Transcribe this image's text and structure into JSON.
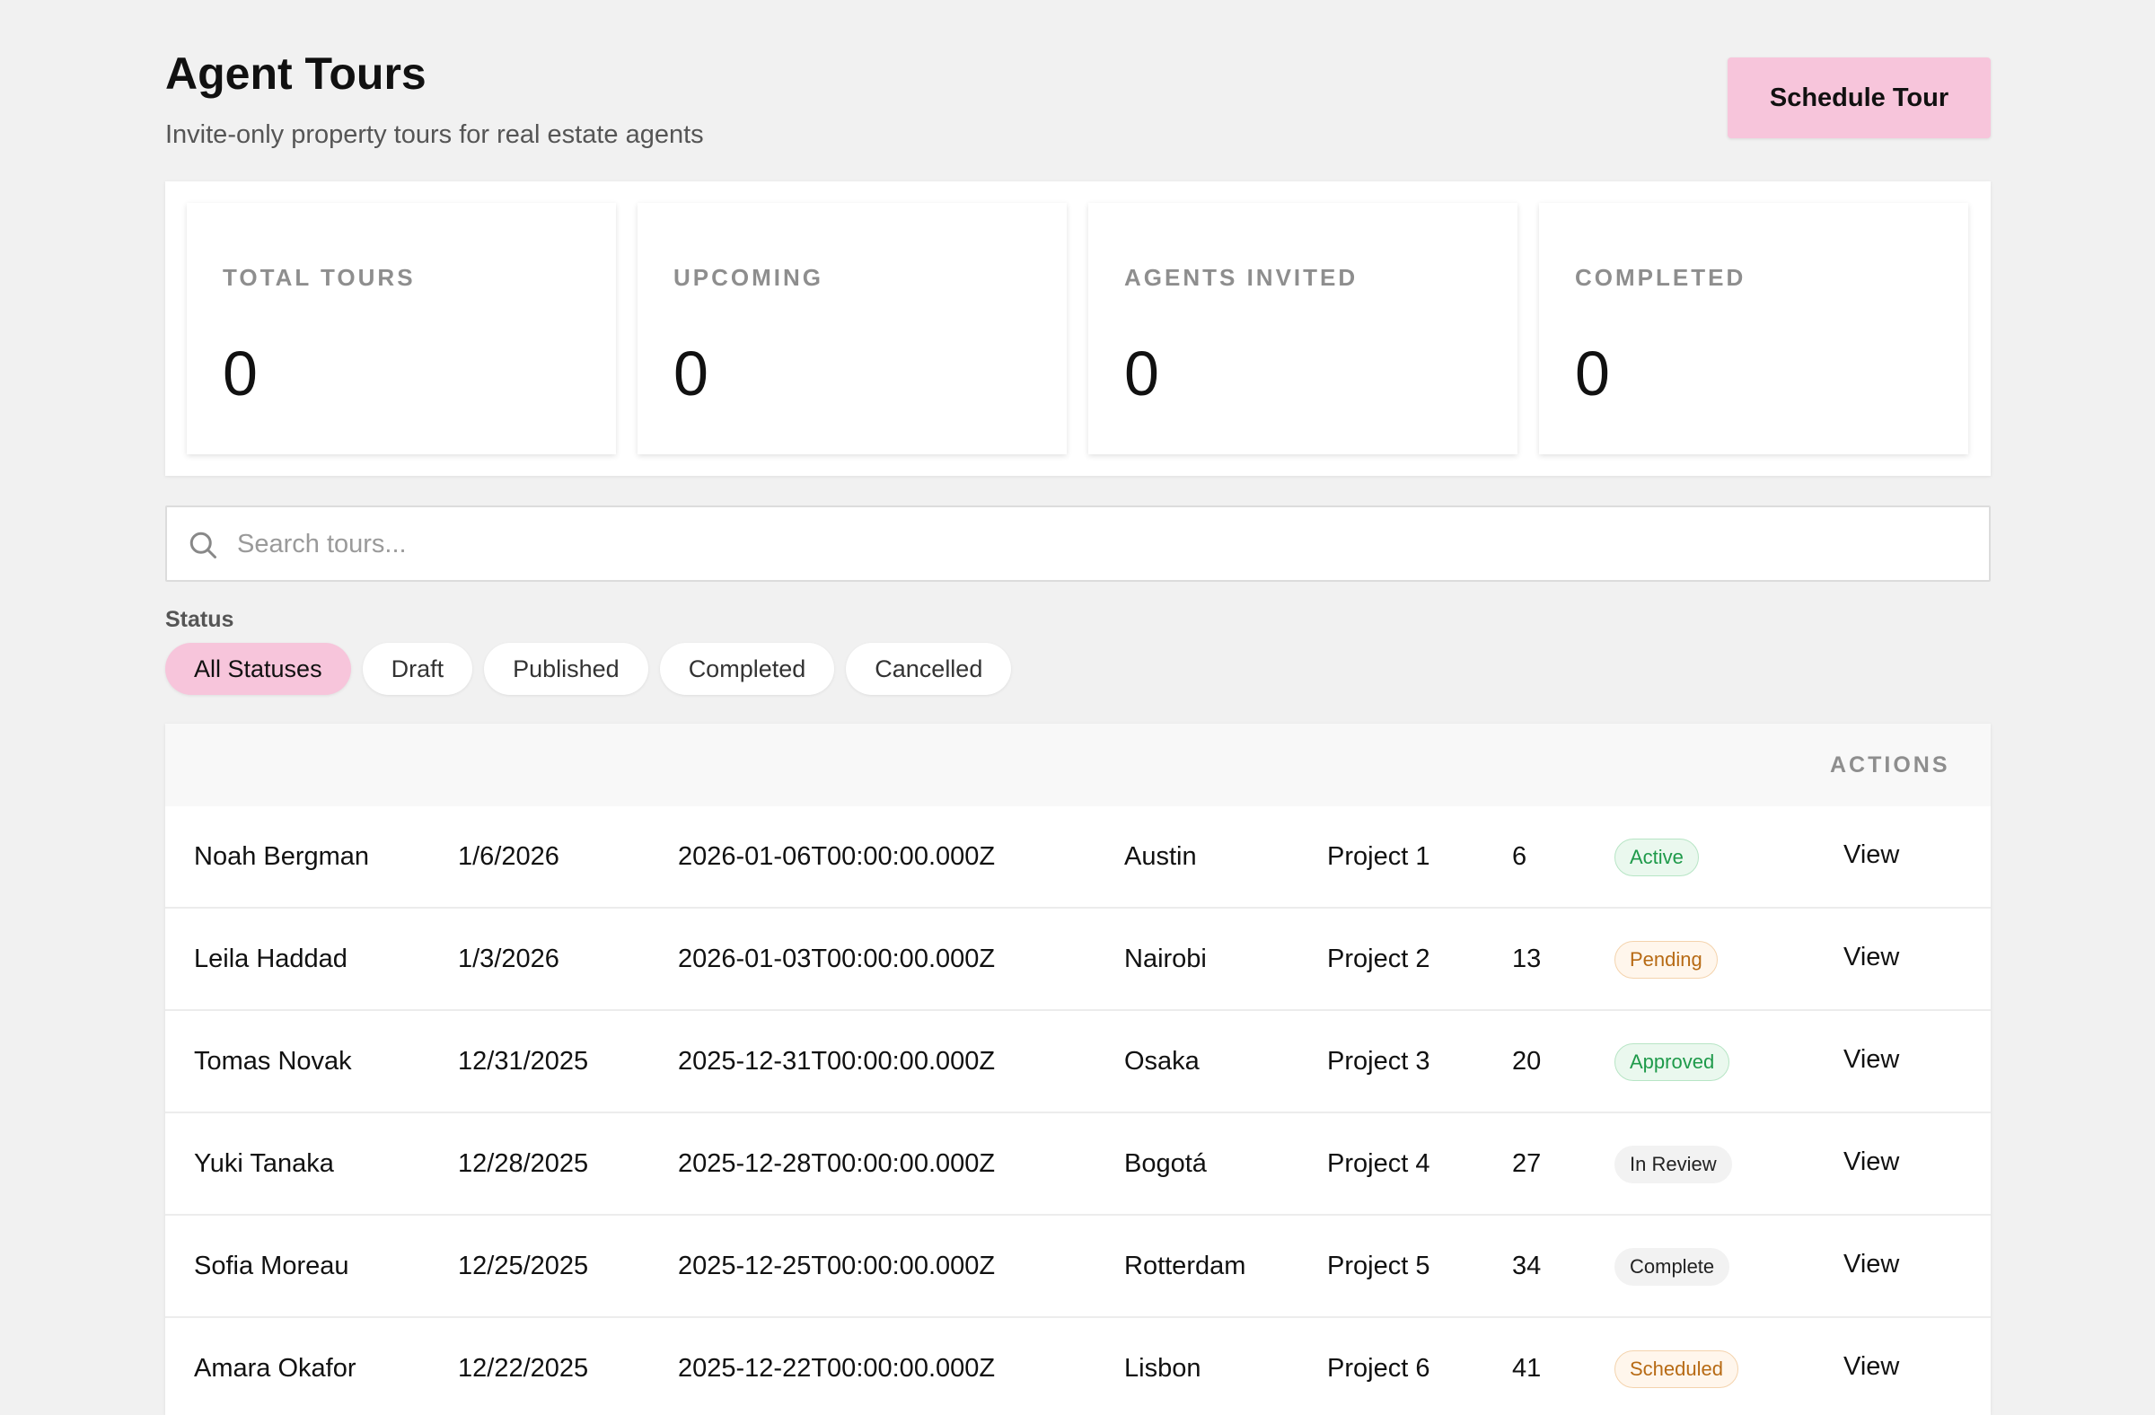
{
  "header": {
    "title": "Agent Tours",
    "subtitle": "Invite-only property tours for real estate agents",
    "schedule_label": "Schedule Tour"
  },
  "stats": [
    {
      "label": "TOTAL TOURS",
      "value": "0"
    },
    {
      "label": "UPCOMING",
      "value": "0"
    },
    {
      "label": "AGENTS INVITED",
      "value": "0"
    },
    {
      "label": "COMPLETED",
      "value": "0"
    }
  ],
  "search": {
    "placeholder": "Search tours...",
    "value": ""
  },
  "filter": {
    "label": "Status",
    "options": [
      "All Statuses",
      "Draft",
      "Published",
      "Completed",
      "Cancelled"
    ],
    "selected": "All Statuses"
  },
  "table": {
    "actions_header": "ACTIONS",
    "rows": [
      {
        "name": "Noah Bergman",
        "date": "1/6/2026",
        "iso": "2026-01-06T00:00:00.000Z",
        "city": "Austin",
        "project": "Project 1",
        "count": "6",
        "status": "Active",
        "status_tone": "green",
        "action": "View"
      },
      {
        "name": "Leila Haddad",
        "date": "1/3/2026",
        "iso": "2026-01-03T00:00:00.000Z",
        "city": "Nairobi",
        "project": "Project 2",
        "count": "13",
        "status": "Pending",
        "status_tone": "amber",
        "action": "View"
      },
      {
        "name": "Tomas Novak",
        "date": "12/31/2025",
        "iso": "2025-12-31T00:00:00.000Z",
        "city": "Osaka",
        "project": "Project 3",
        "count": "20",
        "status": "Approved",
        "status_tone": "green",
        "action": "View"
      },
      {
        "name": "Yuki Tanaka",
        "date": "12/28/2025",
        "iso": "2025-12-28T00:00:00.000Z",
        "city": "Bogotá",
        "project": "Project 4",
        "count": "27",
        "status": "In Review",
        "status_tone": "grey",
        "action": "View"
      },
      {
        "name": "Sofia Moreau",
        "date": "12/25/2025",
        "iso": "2025-12-25T00:00:00.000Z",
        "city": "Rotterdam",
        "project": "Project 5",
        "count": "34",
        "status": "Complete",
        "status_tone": "grey",
        "action": "View"
      },
      {
        "name": "Amara Okafor",
        "date": "12/22/2025",
        "iso": "2025-12-22T00:00:00.000Z",
        "city": "Lisbon",
        "project": "Project 6",
        "count": "41",
        "status": "Scheduled",
        "status_tone": "amber",
        "action": "View"
      }
    ]
  },
  "colors": {
    "accent": "#f7c5db",
    "background": "#f1f1f1",
    "success": "#1e9a4a",
    "warning": "#b76a14"
  },
  "icons": {
    "search": "search-icon"
  }
}
